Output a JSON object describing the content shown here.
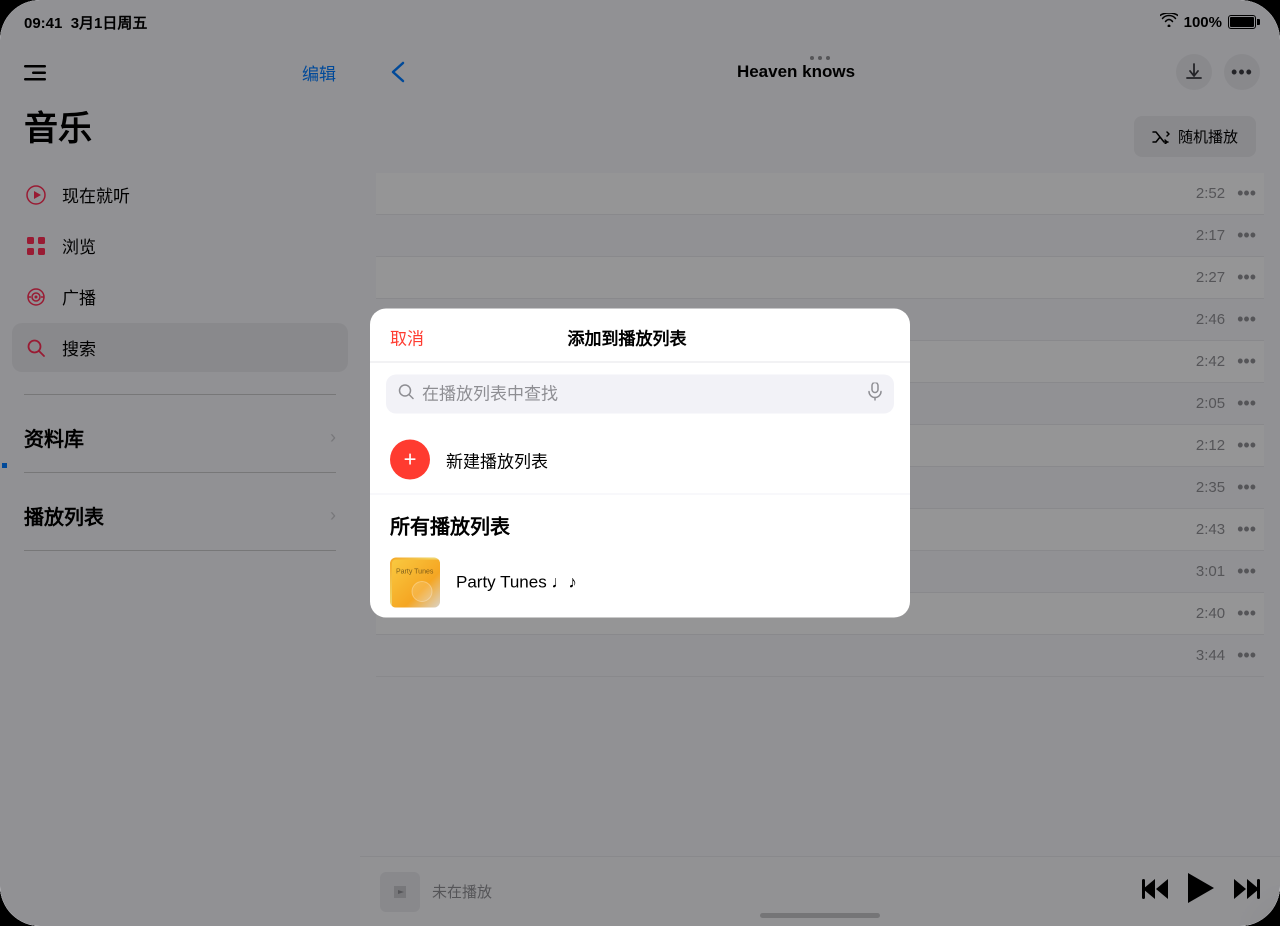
{
  "statusBar": {
    "time": "09:41",
    "date": "3月1日周五",
    "wifi": "wifi",
    "battery": "100%"
  },
  "sidebar": {
    "editLabel": "编辑",
    "appTitle": "音乐",
    "navItems": [
      {
        "id": "listen-now",
        "label": "现在就听",
        "icon": "▶"
      },
      {
        "id": "browse",
        "label": "浏览",
        "icon": "⊞"
      },
      {
        "id": "radio",
        "label": "广播",
        "icon": "◉"
      },
      {
        "id": "search",
        "label": "搜索",
        "icon": "🔍"
      }
    ],
    "sections": [
      {
        "id": "library",
        "label": "资料库"
      },
      {
        "id": "playlist",
        "label": "播放列表"
      }
    ]
  },
  "rightPanel": {
    "title": "Heaven knows",
    "shuffleLabel": "随机播放",
    "songs": [
      {
        "duration": "2:52"
      },
      {
        "duration": "2:17"
      },
      {
        "duration": "2:27"
      },
      {
        "duration": "2:46"
      },
      {
        "duration": "2:42"
      },
      {
        "duration": "2:05"
      },
      {
        "duration": "2:12"
      },
      {
        "duration": "2:35"
      },
      {
        "duration": "2:43"
      },
      {
        "duration": "3:01"
      },
      {
        "duration": "2:40"
      },
      {
        "duration": "3:44"
      }
    ]
  },
  "bottomBar": {
    "nowPlayingLabel": "未在播放"
  },
  "modal": {
    "cancelLabel": "取消",
    "titleLabel": "添加到播放列表",
    "searchPlaceholder": "在播放列表中查找",
    "newPlaylistLabel": "新建播放列表",
    "sectionLabel": "所有播放列表",
    "playlists": [
      {
        "id": "party-tunes",
        "name": "Party Tunes ♩♪",
        "thumbnail": "party-tunes-art"
      }
    ]
  }
}
